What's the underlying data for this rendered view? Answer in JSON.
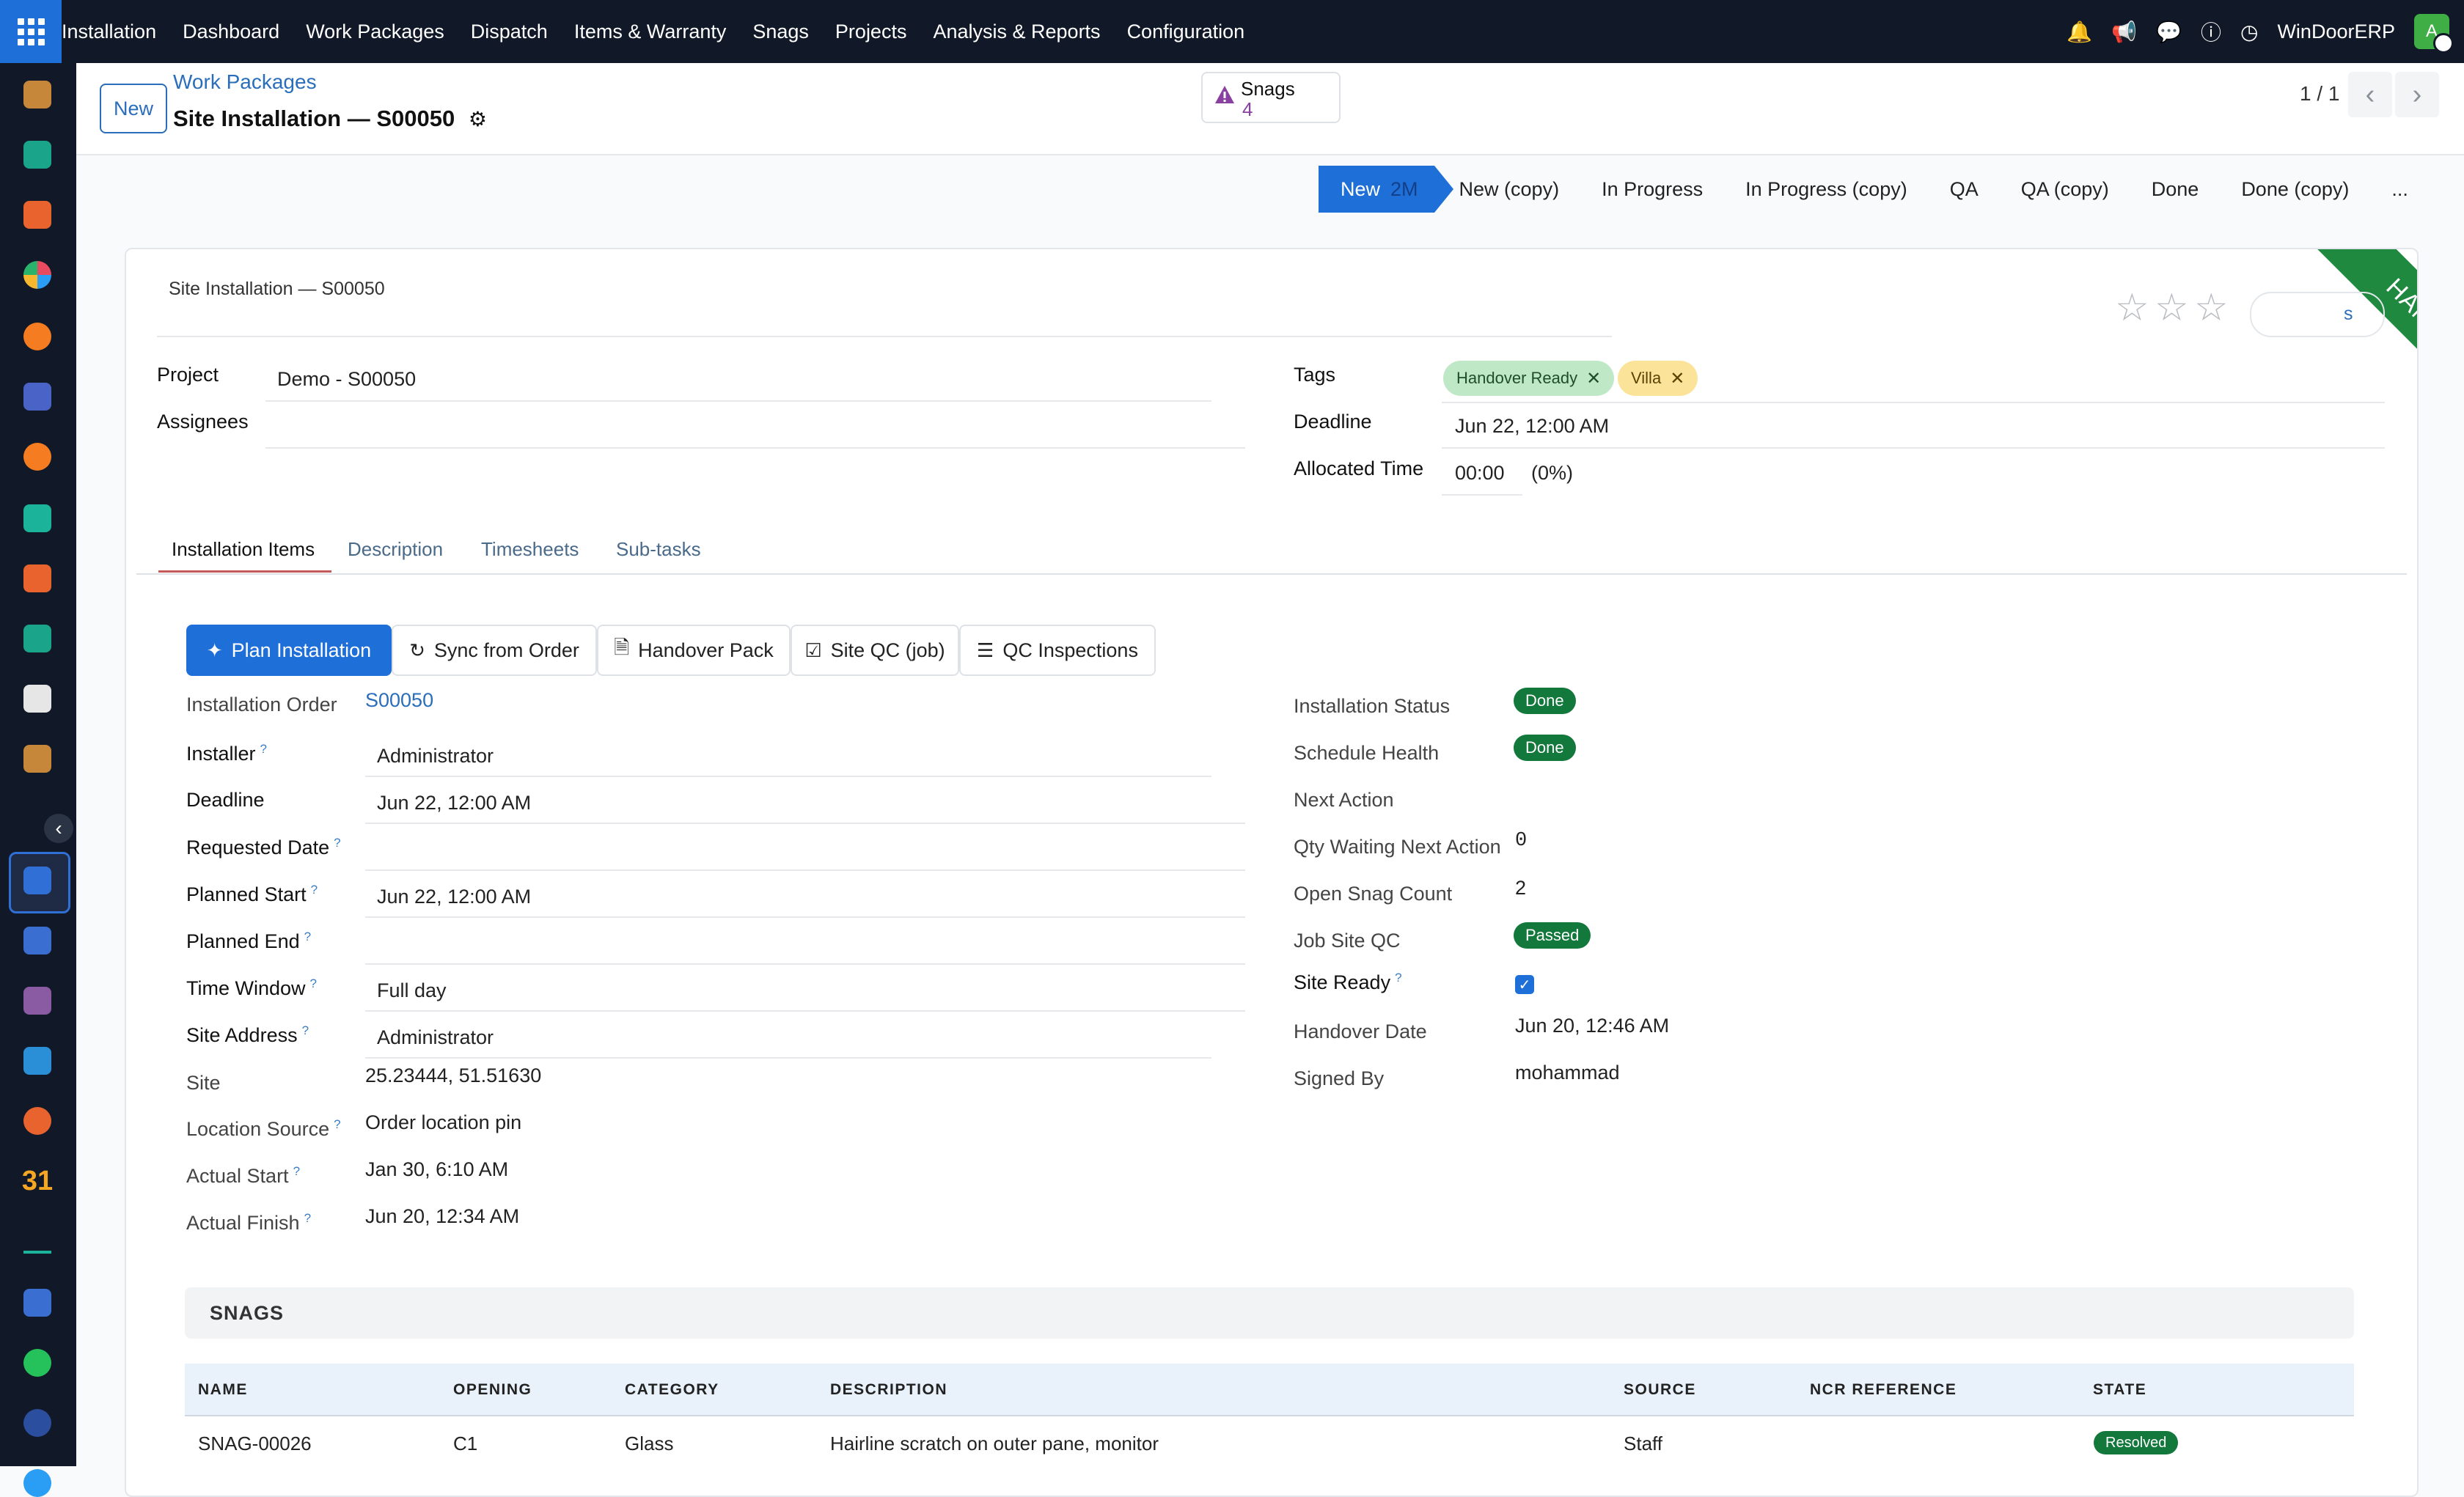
{
  "nav": {
    "app_name": "Installation",
    "menu": [
      "Dashboard",
      "Work Packages",
      "Dispatch",
      "Items & Warranty",
      "Snags",
      "Projects",
      "Analysis & Reports",
      "Configuration"
    ],
    "company": "WinDoorERP",
    "avatar_letter": "A"
  },
  "sidebar": {
    "icons": [
      "app-icon-1",
      "app-icon-2",
      "app-icon-3",
      "app-icon-4",
      "app-icon-5",
      "app-icon-6",
      "app-icon-7",
      "app-icon-8",
      "app-icon-9",
      "app-icon-10",
      "app-icon-11",
      "app-icon-12",
      "installation-app-icon",
      "app-icon-14",
      "app-icon-15",
      "app-icon-16",
      "app-icon-17",
      "calendar-app-icon",
      "app-icon-19",
      "app-icon-20",
      "whatsapp-app-icon",
      "app-icon-22",
      "app-icon-23"
    ],
    "calendar_label": "31"
  },
  "control": {
    "new_label": "New",
    "breadcrumb": "Work Packages",
    "title": "Site Installation — S00050",
    "snags_label": "Snags",
    "snags_count": "4",
    "pager": "1 / 1"
  },
  "statusbar": {
    "active_stage": "New",
    "active_duration": "2M",
    "stages": [
      "New (copy)",
      "In Progress",
      "In Progress (copy)",
      "QA",
      "QA (copy)",
      "Done",
      "Done (copy)"
    ],
    "more": "..."
  },
  "header": {
    "name": "Site Installation — S00050",
    "ribbon": "HANDED OVER",
    "partial_button": "s"
  },
  "fields_left": {
    "project_label": "Project",
    "project_value": "Demo - S00050",
    "assignees_label": "Assignees"
  },
  "fields_right": {
    "tags_label": "Tags",
    "tags": [
      {
        "label": "Handover Ready",
        "color": "#bfe8c7"
      },
      {
        "label": "Villa",
        "color": "#fbe39a"
      }
    ],
    "deadline_label": "Deadline",
    "deadline_value": "Jun 22, 12:00 AM",
    "allocated_label": "Allocated Time",
    "allocated_value": "00:00",
    "allocated_pct": "(0%)"
  },
  "tabs": [
    "Installation Items",
    "Description",
    "Timesheets",
    "Sub-tasks"
  ],
  "actions": {
    "plan": "Plan Installation",
    "sync": "Sync from Order",
    "handover": "Handover Pack",
    "site_qc": "Site QC (job)",
    "qc_inspections": "QC Inspections"
  },
  "installation": {
    "order_label": "Installation Order",
    "order_value": "S00050",
    "installer_label": "Installer",
    "installer_value": "Administrator",
    "deadline_label": "Deadline",
    "deadline_value": "Jun 22, 12:00 AM",
    "requested_label": "Requested Date",
    "planned_start_label": "Planned Start",
    "planned_start_value": "Jun 22, 12:00 AM",
    "planned_end_label": "Planned End",
    "time_window_label": "Time Window",
    "time_window_value": "Full day",
    "site_address_label": "Site Address",
    "site_address_value": "Administrator",
    "site_label": "Site",
    "site_value": "25.23444, 51.51630",
    "location_source_label": "Location Source",
    "location_source_value": "Order location pin",
    "actual_start_label": "Actual Start",
    "actual_start_value": "Jan 30, 6:10 AM",
    "actual_finish_label": "Actual Finish",
    "actual_finish_value": "Jun 20, 12:34 AM"
  },
  "status": {
    "install_status_label": "Installation Status",
    "install_status_value": "Done",
    "schedule_health_label": "Schedule Health",
    "schedule_health_value": "Done",
    "next_action_label": "Next Action",
    "qty_waiting_label": "Qty Waiting Next Action",
    "qty_waiting_value": "0",
    "open_snag_label": "Open Snag Count",
    "open_snag_value": "2",
    "job_site_qc_label": "Job Site QC",
    "job_site_qc_value": "Passed",
    "site_ready_label": "Site Ready",
    "handover_date_label": "Handover Date",
    "handover_date_value": "Jun 20, 12:46 AM",
    "signed_by_label": "Signed By",
    "signed_by_value": "mohammad"
  },
  "snags": {
    "section_title": "SNAGS",
    "columns": [
      "NAME",
      "OPENING",
      "CATEGORY",
      "DESCRIPTION",
      "SOURCE",
      "NCR REFERENCE",
      "STATE"
    ],
    "rows": [
      {
        "name": "SNAG-00026",
        "opening": "C1",
        "category": "Glass",
        "description": "Hairline scratch on outer pane, monitor",
        "source": "Staff",
        "ncr": "",
        "state": "Resolved"
      }
    ]
  },
  "colors": {
    "primary": "#1f6fd9",
    "navbar": "#111827",
    "success": "#13783b",
    "ribbon": "#1f8a3f",
    "link": "#2a6ebb"
  }
}
